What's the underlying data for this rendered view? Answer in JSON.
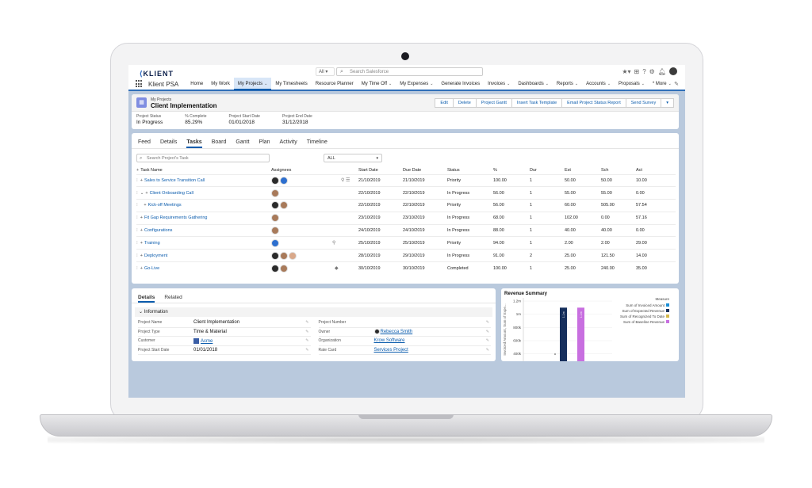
{
  "header": {
    "logo": "KLIENT",
    "search_scope": "All",
    "search_placeholder": "Search Salesforce"
  },
  "nav": {
    "app_name": "Klient PSA",
    "items": [
      {
        "label": "Home",
        "chev": false
      },
      {
        "label": "My Work",
        "chev": false
      },
      {
        "label": "My Projects",
        "chev": true,
        "active": true
      },
      {
        "label": "My Timesheets",
        "chev": false
      },
      {
        "label": "Resource Planner",
        "chev": false
      },
      {
        "label": "My Time Off",
        "chev": true
      },
      {
        "label": "My Expenses",
        "chev": true
      },
      {
        "label": "Generate Invoices",
        "chev": false
      },
      {
        "label": "Invoices",
        "chev": true
      },
      {
        "label": "Dashboards",
        "chev": true
      },
      {
        "label": "Reports",
        "chev": true
      },
      {
        "label": "Accounts",
        "chev": true
      },
      {
        "label": "Proposals",
        "chev": true
      },
      {
        "label": "* More",
        "chev": true
      }
    ]
  },
  "record": {
    "object_label": "My Projects",
    "title": "Client Implementation",
    "actions": [
      "Edit",
      "Delete",
      "Project Gantt",
      "Insert Task Template",
      "Email Project Status Report",
      "Send Survey"
    ],
    "highlights": [
      {
        "label": "Project Status",
        "value": "In Progress"
      },
      {
        "label": "% Complete",
        "value": "85.29%"
      },
      {
        "label": "Project Start Date",
        "value": "01/01/2018"
      },
      {
        "label": "Project End Date",
        "value": "31/12/2018"
      }
    ]
  },
  "tasks_panel": {
    "tabs": [
      "Feed",
      "Details",
      "Tasks",
      "Board",
      "Gantt",
      "Plan",
      "Activity",
      "Timeline"
    ],
    "active_tab": "Tasks",
    "search_placeholder": "Search Project's Task",
    "filter_value": "ALL",
    "columns": [
      "Task Name",
      "Assignees",
      "Start Date",
      "Due Date",
      "Status",
      "%",
      "Dur",
      "Est",
      "Sch",
      "Act"
    ],
    "rows": [
      {
        "name": "Sales to Service Transition Call",
        "indent": 0,
        "expand": false,
        "avatars": [
          "a1",
          "a2"
        ],
        "icons": "⚲ ☰",
        "start": "21/10/2019",
        "due": "21/10/2019",
        "status": "Priority",
        "status_color": "",
        "pct": "100.00",
        "dur": "1",
        "est": "50.00",
        "sch": "50.00",
        "act": "10.00"
      },
      {
        "name": "Client Onboarding Call",
        "indent": 0,
        "expand": true,
        "avatars": [
          "a3"
        ],
        "icons": "",
        "start": "22/10/2019",
        "due": "22/10/2019",
        "status": "In Progress",
        "status_color": "green",
        "pct": "56.00",
        "dur": "1",
        "est": "55.00",
        "sch": "55.00",
        "act": "0.00"
      },
      {
        "name": "Kick-off Meetings",
        "indent": 1,
        "expand": false,
        "avatars": [
          "a1",
          "a3"
        ],
        "icons": "",
        "start": "22/10/2019",
        "due": "22/10/2019",
        "status": "Priority",
        "status_color": "",
        "pct": "56.00",
        "dur": "1",
        "est": "60.00",
        "sch": "505.00",
        "act": "57.54"
      },
      {
        "name": "Fit Gap Requirements Gathering",
        "indent": 0,
        "expand": false,
        "avatars": [
          "a3"
        ],
        "icons": "",
        "start": "23/10/2019",
        "due": "23/10/2019",
        "status": "In Progress",
        "status_color": "green",
        "pct": "68.00",
        "dur": "1",
        "est": "102.00",
        "sch": "0.00",
        "act": "57.16"
      },
      {
        "name": "Configurations",
        "indent": 0,
        "expand": false,
        "avatars": [
          "a3"
        ],
        "icons": "",
        "start": "24/10/2019",
        "due": "24/10/2019",
        "status": "In Progress",
        "status_color": "green",
        "pct": "88.00",
        "dur": "1",
        "est": "40.00",
        "sch": "40.00",
        "act": "0.00"
      },
      {
        "name": "Training",
        "indent": 0,
        "expand": false,
        "avatars": [
          "a2"
        ],
        "icons": "⚲",
        "start": "25/10/2019",
        "due": "25/10/2019",
        "status": "Priority",
        "status_color": "",
        "pct": "94.00",
        "dur": "1",
        "est": "2.00",
        "sch": "2.00",
        "act": "29.00"
      },
      {
        "name": "Deployment",
        "indent": 0,
        "expand": false,
        "avatars": [
          "a1",
          "a3",
          "a4"
        ],
        "icons": "",
        "start": "28/10/2019",
        "due": "29/10/2019",
        "status": "In Progress",
        "status_color": "green",
        "pct": "91.00",
        "dur": "2",
        "est": "25.00",
        "sch": "121.50",
        "act": "14.00"
      },
      {
        "name": "Go-Live",
        "indent": 0,
        "expand": false,
        "avatars": [
          "a1",
          "a3"
        ],
        "icons": "◆",
        "start": "30/10/2019",
        "due": "30/10/2019",
        "status": "Completed",
        "status_color": "blue",
        "pct": "100.00",
        "dur": "1",
        "est": "25.00",
        "sch": "240.00",
        "act": "35.00"
      }
    ]
  },
  "details_panel": {
    "tabs": [
      "Details",
      "Related"
    ],
    "section": "Information",
    "left_fields": [
      {
        "label": "Project Name",
        "value": "Client Implementation",
        "link": false
      },
      {
        "label": "Project Type",
        "value": "Time & Material",
        "link": false
      },
      {
        "label": "Customer",
        "value": "Acme",
        "link": true,
        "icon": true
      },
      {
        "label": "Project Start Date",
        "value": "01/01/2018",
        "link": false
      }
    ],
    "right_fields": [
      {
        "label": "Project Number",
        "value": "",
        "link": false
      },
      {
        "label": "Owner",
        "value": "Rebecca Smith",
        "link": true,
        "avatar": true
      },
      {
        "label": "Organization",
        "value": "Krow Software",
        "link": true
      },
      {
        "label": "Rate Card",
        "value": "Services Project",
        "link": true
      }
    ]
  },
  "revenue": {
    "title": "Revenue Summary",
    "legend_title": "Measure",
    "colors": {
      "invoiced": "#1b8fd6",
      "expected": "#162f5c",
      "recognized": "#d4b84a",
      "baseline": "#c86fe0"
    },
    "y_axis_label": "Invoiced Amount, Sum of Expe...",
    "bar_labels": [
      "1.1m",
      "1.1m"
    ],
    "chart_data": {
      "type": "bar",
      "categories": [
        ""
      ],
      "series": [
        {
          "name": "Sum of Invoiced Amount",
          "values": [
            0
          ]
        },
        {
          "name": "Sum of Expected Revenue",
          "values": [
            1100000
          ]
        },
        {
          "name": "Sum of Recognized To Date",
          "values": [
            0
          ]
        },
        {
          "name": "Sum of Baseline Revenue",
          "values": [
            1100000
          ]
        }
      ],
      "yticks": [
        "1.2m",
        "1m",
        "800k",
        "600k",
        "400k"
      ],
      "ylim": [
        0,
        1200000
      ],
      "legend": "right"
    }
  }
}
